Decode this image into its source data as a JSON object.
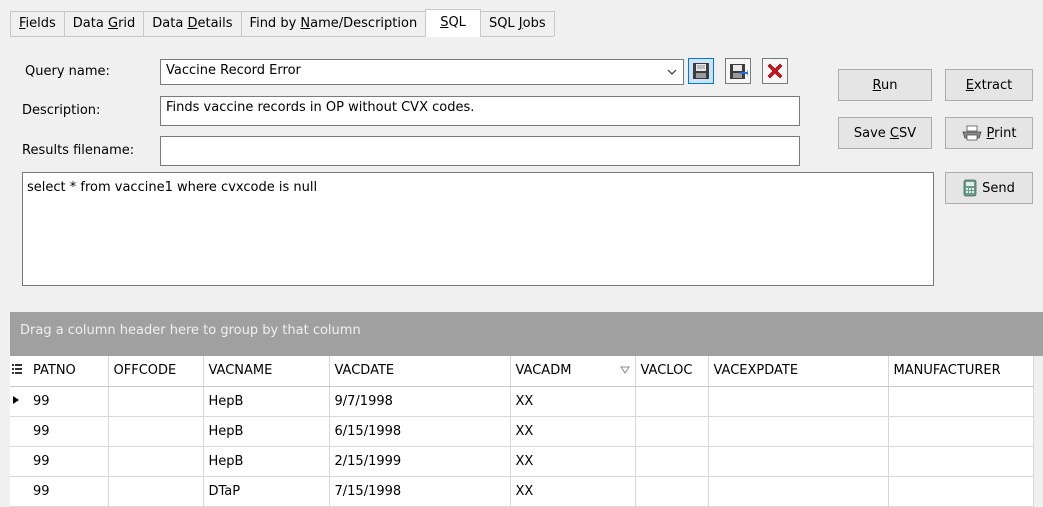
{
  "tabs": [
    {
      "pre": "",
      "ul": "F",
      "post": "ields"
    },
    {
      "pre": "Data ",
      "ul": "G",
      "post": "rid"
    },
    {
      "pre": "Data ",
      "ul": "D",
      "post": "etails"
    },
    {
      "pre": "Find by ",
      "ul": "N",
      "post": "ame/Description"
    },
    {
      "pre": "",
      "ul": "S",
      "post": "QL"
    },
    {
      "pre": "SQL ",
      "ul": "J",
      "post": "obs"
    }
  ],
  "form": {
    "query_name_label": "Query name:",
    "query_name_value": "Vaccine Record Error",
    "description_label": "Description:",
    "description_value": "Finds vaccine records in OP without CVX codes.",
    "results_filename_label": "Results filename:",
    "results_filename_value": "",
    "sql_text": "select * from vaccine1 where cvxcode is null"
  },
  "buttons": {
    "run": {
      "pre": "",
      "ul": "R",
      "post": "un"
    },
    "extract": {
      "pre": "",
      "ul": "E",
      "post": "xtract"
    },
    "save_csv": {
      "pre": "Save ",
      "ul": "C",
      "post": "SV"
    },
    "print": {
      "pre": "",
      "ul": "P",
      "post": "rint"
    },
    "send": "Send"
  },
  "grid": {
    "group_hint": "Drag a column header here to group by that column",
    "columns": [
      "PATNO",
      "OFFCODE",
      "VACNAME",
      "VACDATE",
      "VACADM",
      "VACLOC",
      "VACEXPDATE",
      "MANUFACTURER"
    ],
    "rows": [
      [
        "99",
        "",
        "HepB",
        "9/7/1998",
        "XX",
        "",
        "",
        ""
      ],
      [
        "99",
        "",
        "HepB",
        "6/15/1998",
        "XX",
        "",
        "",
        ""
      ],
      [
        "99",
        "",
        "HepB",
        "2/15/1999",
        "XX",
        "",
        "",
        ""
      ],
      [
        "99",
        "",
        "DTaP",
        "7/15/1998",
        "XX",
        "",
        "",
        ""
      ]
    ]
  },
  "icons": {
    "save": "floppy-disk-icon",
    "save_as": "floppy-disk-arrow-icon",
    "delete": "red-x-icon",
    "printer": "printer-icon",
    "send": "send-icon",
    "column_chooser": "column-chooser-icon",
    "sort": "filter-triangle-icon",
    "row_indicator": "row-indicator-icon"
  },
  "colors": {
    "delete_red": "#d0141e",
    "selected_blue": "#0078d7",
    "group_bar": "#a0a0a0"
  }
}
